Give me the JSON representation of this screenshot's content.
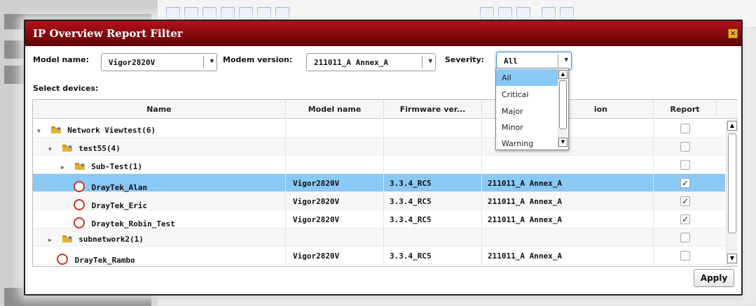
{
  "dialog": {
    "title": "IP Overview Report Filter",
    "close_glyph": "×"
  },
  "filters": {
    "model_label": "Model name:",
    "model_value": "Vigor2820V",
    "modem_label": "Modem version:",
    "modem_value": "211011_A Annex_A",
    "severity_label": "Severity:",
    "severity_value": "All",
    "severity_options": [
      "All",
      "Critical",
      "Major",
      "Minor",
      "Warning"
    ]
  },
  "select_devices_label": "Select devices:",
  "grid": {
    "headers": [
      "Name",
      "Model name",
      "Firmware ver...",
      "ion",
      "Report"
    ],
    "rows": [
      {
        "name": "Network Viewtest(6)",
        "model": "",
        "firmware": "",
        "modem": "",
        "report": false,
        "type": "folder",
        "expander": "▼"
      },
      {
        "name": "test55(4)",
        "model": "",
        "firmware": "",
        "modem": "",
        "report": false,
        "type": "folder",
        "expander": "▼"
      },
      {
        "name": "Sub-Test(1)",
        "model": "",
        "firmware": "",
        "modem": "",
        "report": false,
        "type": "folder",
        "expander": "▶"
      },
      {
        "name": "DrayTek_Alan",
        "model": "Vigor2820V",
        "firmware": "3.3.4_RC5",
        "modem": "211011_A Annex_A",
        "report": true,
        "type": "device",
        "selected": true
      },
      {
        "name": "DrayTek_Eric",
        "model": "Vigor2820V",
        "firmware": "3.3.4_RC5",
        "modem": "211011_A Annex_A",
        "report": true,
        "type": "device"
      },
      {
        "name": "Draytek_Robin_Test",
        "model": "Vigor2820V",
        "firmware": "3.3.4_RC5",
        "modem": "211011_A Annex_A",
        "report": true,
        "type": "device"
      },
      {
        "name": "subnetwork2(1)",
        "model": "",
        "firmware": "",
        "modem": "",
        "report": false,
        "type": "folder",
        "expander": "▶"
      },
      {
        "name": "DrayTek_Rambo",
        "model": "Vigor2820V",
        "firmware": "3.3.4_RC5",
        "modem": "211011_A Annex_A",
        "report": false,
        "type": "device"
      }
    ]
  },
  "apply_label": "Apply",
  "colors": {
    "title_bar": "#8d0b10",
    "selection": "#8ac8f5",
    "close_button": "#e8b428"
  }
}
